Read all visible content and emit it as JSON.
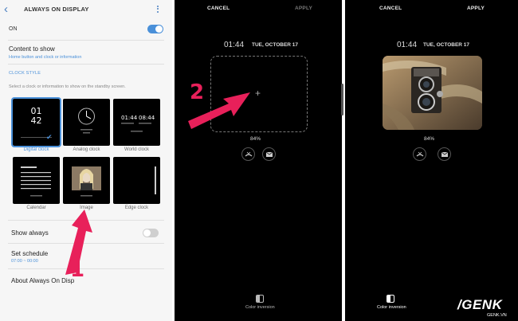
{
  "settings": {
    "title": "ALWAYS ON DISPLAY",
    "on_label": "ON",
    "content_to_show": {
      "label": "Content to show",
      "value": "Home button and clock or information"
    },
    "clock_style_section": "CLOCK STYLE",
    "instruction": "Select a clock or information to show on the standby screen.",
    "tiles": [
      {
        "label": "Digital clock",
        "time_hour": "01",
        "time_minute": "42"
      },
      {
        "label": "Analog clock"
      },
      {
        "label": "World clock"
      },
      {
        "label": "Calendar"
      },
      {
        "label": "Image"
      },
      {
        "label": "Edge clock"
      }
    ],
    "show_always": "Show always",
    "set_schedule": {
      "label": "Set schedule",
      "value": "07:00 ~ 00:00"
    },
    "about": "About Always On Disp"
  },
  "editor_empty": {
    "cancel": "CANCEL",
    "apply": "APPLY",
    "time": "01:44",
    "date": "TUE, OCTOBER 17",
    "battery": "84%",
    "color_inversion": "Color inversion"
  },
  "editor_image": {
    "cancel": "CANCEL",
    "apply": "APPLY",
    "time": "01:44",
    "date": "TUE, OCTOBER 17",
    "battery": "84%",
    "color_inversion": "Color inversion"
  },
  "annotations": {
    "step1": "1",
    "step2": "2"
  },
  "watermark": {
    "brand": "GENK",
    "domain": "GENK.VN"
  },
  "colors": {
    "accent": "#4a90d9",
    "annotation": "#e8205a",
    "toggle_on": "#4a90d9",
    "toggle_off": "#cfcfcf"
  }
}
